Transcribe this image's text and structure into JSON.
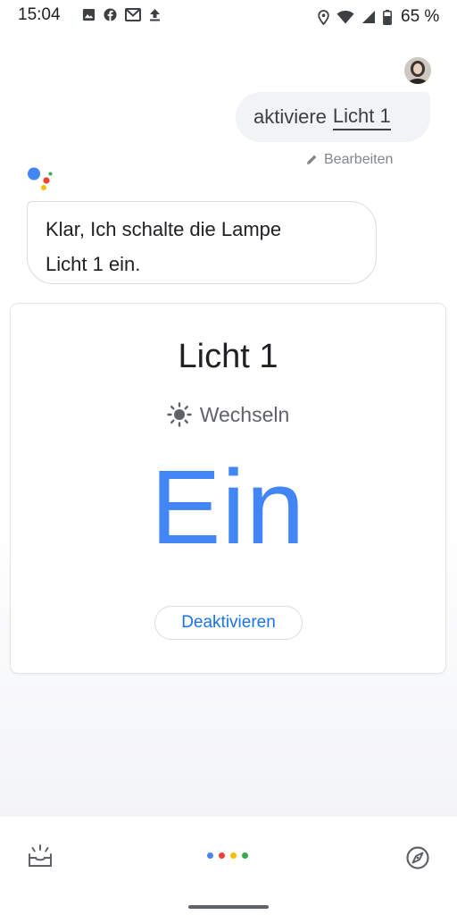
{
  "status_bar": {
    "time": "15:04",
    "battery_percent": "65 %",
    "icons_left": [
      "image-icon",
      "facebook-icon",
      "gmail-icon",
      "upload-icon"
    ],
    "icons_right": [
      "location-icon",
      "wifi-icon",
      "signal-icon",
      "battery-icon"
    ]
  },
  "conversation": {
    "user_query_prefix": "aktiviere",
    "user_query_entity": "Licht 1",
    "edit_label": "Bearbeiten",
    "assistant_reply_line1": "Klar, Ich schalte die Lampe",
    "assistant_reply_line2": "Licht 1 ein."
  },
  "card": {
    "device_name": "Licht 1",
    "mode_icon": "sun-icon",
    "mode_label": "Wechseln",
    "state": "Ein",
    "action_button": "Deaktivieren"
  },
  "bottom_bar": {
    "left_icon": "updates-icon",
    "right_icon": "explore-compass-icon"
  },
  "colors": {
    "assistant_blue": "#4285f4",
    "assistant_red": "#ea4335",
    "assistant_yellow": "#fbbc04",
    "assistant_green": "#34a853",
    "link_blue": "#1a73e8"
  }
}
